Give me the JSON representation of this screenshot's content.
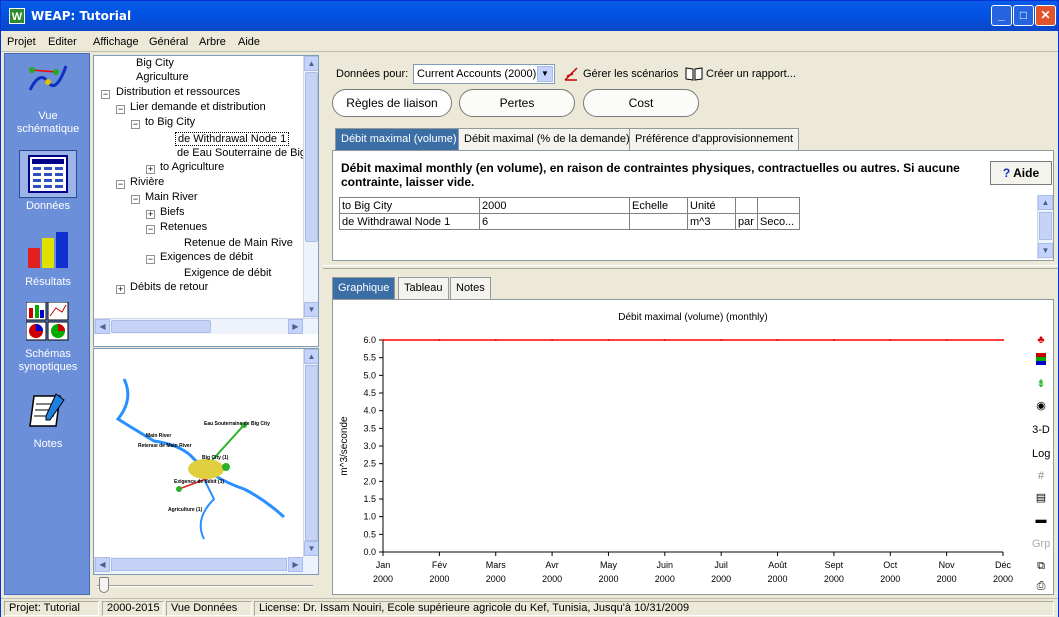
{
  "window": {
    "title": "WEAP: Tutorial",
    "app_letter": "W"
  },
  "menu": [
    "Projet",
    "Editer",
    "Affichage",
    "Général",
    "Arbre",
    "Aide"
  ],
  "sidebar": {
    "items": [
      {
        "label1": "Vue",
        "label2": "schématique"
      },
      {
        "label1": "Données",
        "label2": ""
      },
      {
        "label1": "Résultats",
        "label2": ""
      },
      {
        "label1": "Schémas",
        "label2": "synoptiques"
      },
      {
        "label1": "Notes",
        "label2": ""
      }
    ]
  },
  "tree": [
    "Big City",
    "Agriculture",
    "Distribution et ressources",
    "Lier demande et distribution",
    "to Big City",
    "de Withdrawal Node 1",
    "de Eau Souterraine de Big",
    "to Agriculture",
    "Rivière",
    "Main River",
    "Biefs",
    "Retenues",
    "Retenue de Main Rive",
    "Exigences de débit",
    "Exigence de débit",
    "Débits de retour"
  ],
  "map": {
    "labels": [
      "Eau Souterraine de Big City",
      "Main River",
      "Retenue de Main River",
      "Big City (1)",
      "Exigence de débit (1)",
      "Agriculture (1)"
    ]
  },
  "toolbar": {
    "data_for_label": "Données pour:",
    "scenario_value": "Current Accounts (2000)",
    "manage": "Gérer les scénarios",
    "report": "Créer un rapport..."
  },
  "pills": [
    "Règles de liaison",
    "Pertes",
    "Cost"
  ],
  "tabs": [
    "Débit maximal (volume)",
    "Débit maximal (% de la demande)",
    "Préférence d'approvisionnement"
  ],
  "description": "Débit maximal monthly (en volume), en raison de contraintes physiques, contractuelles ou autres. Si aucune contrainte, laisser vide.",
  "help_label": "Aide",
  "table": {
    "header": [
      "to Big City",
      "2000",
      "Echelle",
      "Unité",
      "",
      ""
    ],
    "row": [
      "de Withdrawal Node 1",
      "6",
      "",
      "m^3",
      "par",
      "Seco..."
    ]
  },
  "view_tabs": [
    "Graphique",
    "Tableau",
    "Notes"
  ],
  "chart_tools": [
    "3-D",
    "Log",
    "Grp"
  ],
  "chart_data": {
    "type": "line",
    "title": "Débit maximal (volume) (monthly)",
    "ylabel": "m^3/seconde",
    "xlabel": "",
    "categories": [
      "Jan",
      "Fév",
      "Mars",
      "Avr",
      "May",
      "Juin",
      "Juil",
      "Août",
      "Sept",
      "Oct",
      "Nov",
      "Déc"
    ],
    "year_labels": [
      "2000",
      "2000",
      "2000",
      "2000",
      "2000",
      "2000",
      "2000",
      "2000",
      "2000",
      "2000",
      "2000",
      "2000"
    ],
    "series": [
      {
        "values": [
          6,
          6,
          6,
          6,
          6,
          6,
          6,
          6,
          6,
          6,
          6,
          6
        ],
        "color": "#ff0000"
      }
    ],
    "ylim": [
      0,
      6
    ],
    "yticks": [
      "0.0",
      "0.5",
      "1.0",
      "1.5",
      "2.0",
      "2.5",
      "3.0",
      "3.5",
      "4.0",
      "4.5",
      "5.0",
      "5.5",
      "6.0"
    ],
    "grid": false
  },
  "status": [
    "Projet: Tutorial",
    "2000-2015",
    "Vue Données",
    "License: Dr. Issam Nouiri, Ecole supérieure agricole du Kef, Tunisia, Jusqu'à 10/31/2009"
  ]
}
